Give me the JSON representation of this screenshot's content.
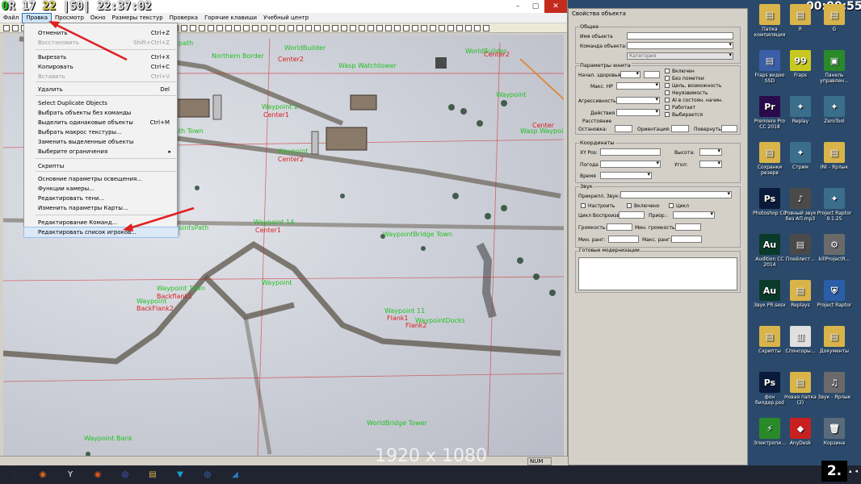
{
  "overlay": {
    "fps_a": "0",
    "fps_mid": "R",
    "fps_b": "17",
    "fps_c": "22",
    "fps_d": "|50|",
    "time": "22:37:02",
    "resolution": "1920 x 1080",
    "badge": "2."
  },
  "menubar": [
    "Файл",
    "Правка",
    "Просмотр",
    "Окно",
    "Размеры текстур",
    "Проверка",
    "Горячие клавиши",
    "Учебный центр"
  ],
  "dropdown": {
    "items": [
      {
        "label": "Отменить",
        "shortcut": "Ctrl+Z",
        "disabled": false
      },
      {
        "label": "Восстановить",
        "shortcut": "Shift+Ctrl+Z",
        "disabled": true
      },
      {
        "label": "Вырезать",
        "shortcut": "Ctrl+X",
        "disabled": false
      },
      {
        "label": "Копировать",
        "shortcut": "Ctrl+C",
        "disabled": false
      },
      {
        "label": "Вставить",
        "shortcut": "Ctrl+V",
        "disabled": true
      },
      {
        "label": "Удалить",
        "shortcut": "Del",
        "disabled": false
      },
      {
        "label": "Select Duplicate Objects",
        "shortcut": "",
        "disabled": false
      },
      {
        "label": "Выбрать объекты без команды",
        "shortcut": "",
        "disabled": false
      },
      {
        "label": "Выделить одинаковые объекты",
        "shortcut": "Ctrl+M",
        "disabled": false
      },
      {
        "label": "Выбрать макрос текстуры...",
        "shortcut": "",
        "disabled": false
      },
      {
        "label": "Заменить выделенные объекты",
        "shortcut": "",
        "disabled": false
      },
      {
        "label": "Выберите ограничения",
        "shortcut": "",
        "disabled": false
      },
      {
        "label": "Скрипты",
        "shortcut": "",
        "disabled": false
      },
      {
        "label": "Основние параметры освещения...",
        "shortcut": "",
        "disabled": false
      },
      {
        "label": "Функции камеры...",
        "shortcut": "",
        "disabled": false
      },
      {
        "label": "Редактировать тени...",
        "shortcut": "",
        "disabled": false
      },
      {
        "label": "Изменить параметры Карты...",
        "shortcut": "",
        "disabled": false
      },
      {
        "label": "Редактирование Команд...",
        "shortcut": "",
        "disabled": false
      },
      {
        "label": "Редактировать список игроков...",
        "shortcut": "",
        "disabled": false
      }
    ]
  },
  "map_labels": {
    "green": [
      "Waypath",
      "Northern Border",
      "WorldBuilder",
      "WorldBuilder",
      "Wasp Watchtower",
      "Waypoint",
      "Waypath Town",
      "Wasp Waypoint",
      "Waypoint 2",
      "Waypoint",
      "WaypointsPath",
      "Waypoint 14",
      "WaypointBridge Town",
      "Waypoint",
      "Waypoint Town",
      "Waypoint",
      "Waypoint 11",
      "WaypointDocks",
      "Waypoint 21",
      "WorldBridge Tower",
      "Waypoint Bank"
    ],
    "red": [
      "Center2",
      "Center1",
      "Center2",
      "Center1",
      "Backflank1",
      "BackFlank2",
      "Flank1",
      "Flank2",
      "Flank1",
      "Center"
    ]
  },
  "statusbar": {
    "num": "NUM"
  },
  "props": {
    "title": "Свойства объекта",
    "general": "Общее",
    "object_name": "Имя объекта",
    "object_team": "Команда объекта:",
    "category": "Категория",
    "unit_params": "Параметры юнита",
    "start_health": "Начал. здоровья",
    "max_hp": "Макс. HP",
    "aggressiveness": "Агрессивность",
    "actions": "Действия",
    "cb_enabled": "Включен",
    "cb_no_hint": "Без пометки",
    "cb_target": "Цель, возможность",
    "cb_invuln": "Неуязвимость",
    "cb_ai": "AI в состоян. начин.",
    "cb_works": "Работает",
    "cb_selected": "Выбирается",
    "distance": "Расстояние",
    "stop": "Остановка:",
    "orient": "Ориентация:",
    "turn": "Повернуть:",
    "coords": "Координаты",
    "xypos": "XY Pos:",
    "height": "Высота:",
    "weather": "Погода",
    "angle": "Угол:",
    "time": "Время",
    "sound": "Звук",
    "attach_sound": "Прикрепл. Звук:",
    "cb_setup": "Настроить",
    "cb_on": "Включено",
    "cb_cycle": "Цикл",
    "cycle_play": "Цикл Воспроизв.",
    "priority": "Приор.:",
    "volume": "Громкость:",
    "min_volume": "Мин. громкость:",
    "min_range": "Мин. ранг:",
    "max_range": "Макс. ранг:",
    "ready_mods": "Готовые модернизации"
  },
  "desktop": {
    "clock": "00:00:55",
    "icons": [
      {
        "label": "Папка компиляция",
        "glyph": "▤",
        "color": "#d9b44a"
      },
      {
        "label": "R",
        "glyph": "▤",
        "color": "#d9b44a"
      },
      {
        "label": "G",
        "glyph": "▤",
        "color": "#d9b44a"
      },
      {
        "label": "Fraps видео SSD",
        "glyph": "▤",
        "color": "#3a5ea8"
      },
      {
        "label": "Fraps",
        "glyph": "99",
        "color": "#c8c820"
      },
      {
        "label": "Панель управлен...",
        "glyph": "▣",
        "color": "#2a8a2a"
      },
      {
        "label": "Premiere Pro CC 2018",
        "glyph": "Pr",
        "color": "#2a0a4a"
      },
      {
        "label": "Replay",
        "glyph": "✦",
        "color": "#3a6e8a"
      },
      {
        "label": "ZeroTool",
        "glyph": "✦",
        "color": "#3a6e8a"
      },
      {
        "label": "Сохранки резерв",
        "glyph": "▤",
        "color": "#d9b44a"
      },
      {
        "label": "Стрим",
        "glyph": "✦",
        "color": "#3a6e8a"
      },
      {
        "label": "INI - Ярлык",
        "glyph": "▤",
        "color": "#d9b44a"
      },
      {
        "label": "Photoshop CC",
        "glyph": "Ps",
        "color": "#0a1a3a"
      },
      {
        "label": "Ровный звук без АП.mp3",
        "glyph": "♪",
        "color": "#4a4a4a"
      },
      {
        "label": "Project Raptor 9.1.25",
        "glyph": "✦",
        "color": "#3a6e8a"
      },
      {
        "label": "Audition CC 2014",
        "glyph": "Au",
        "color": "#0a3a2a"
      },
      {
        "label": "Плейлист...",
        "glyph": "▤",
        "color": "#4a4a4a"
      },
      {
        "label": "killProjectR...",
        "glyph": "⚙",
        "color": "#6a6a6a"
      },
      {
        "label": "Звук PR.sesx",
        "glyph": "Au",
        "color": "#0a3a2a"
      },
      {
        "label": "Replays",
        "glyph": "▤",
        "color": "#d9b44a"
      },
      {
        "label": "Project Raptor",
        "glyph": "⛨",
        "color": "#2a5ea8"
      },
      {
        "label": "Скрипты",
        "glyph": "▤",
        "color": "#d9b44a"
      },
      {
        "label": "Спонсоры...",
        "glyph": "▥",
        "color": "#e0e0e0"
      },
      {
        "label": "Документы",
        "glyph": "▤",
        "color": "#d9b44a"
      },
      {
        "label": "фон билдер.psd",
        "glyph": "Ps",
        "color": "#0a1a3a"
      },
      {
        "label": "Новая папка (2)",
        "glyph": "▤",
        "color": "#d9b44a"
      },
      {
        "label": "Звук - Ярлык",
        "glyph": "♫",
        "color": "#6a6a6a"
      },
      {
        "label": "Электропи...",
        "glyph": "⚡",
        "color": "#2a8a2a"
      },
      {
        "label": "AnyDesk",
        "glyph": "◆",
        "color": "#c82020"
      },
      {
        "label": "Корзина",
        "glyph": "🗑",
        "color": "#5a6a7a"
      }
    ]
  },
  "taskbar": {
    "lang": "RU",
    "apps": [
      {
        "glyph": "⊞",
        "color": "#2a2a2a"
      },
      {
        "glyph": "◉",
        "color": "#e86a1a"
      },
      {
        "glyph": "Y",
        "color": "#ffffff"
      },
      {
        "glyph": "◉",
        "color": "#e85a1a"
      },
      {
        "glyph": "◎",
        "color": "#5865f2"
      },
      {
        "glyph": "▤",
        "color": "#d9b44a"
      },
      {
        "glyph": "▼",
        "color": "#1a9ed0"
      },
      {
        "glyph": "◍",
        "color": "#3a5ea8"
      },
      {
        "glyph": "◢",
        "color": "#2a7ac8"
      }
    ]
  }
}
